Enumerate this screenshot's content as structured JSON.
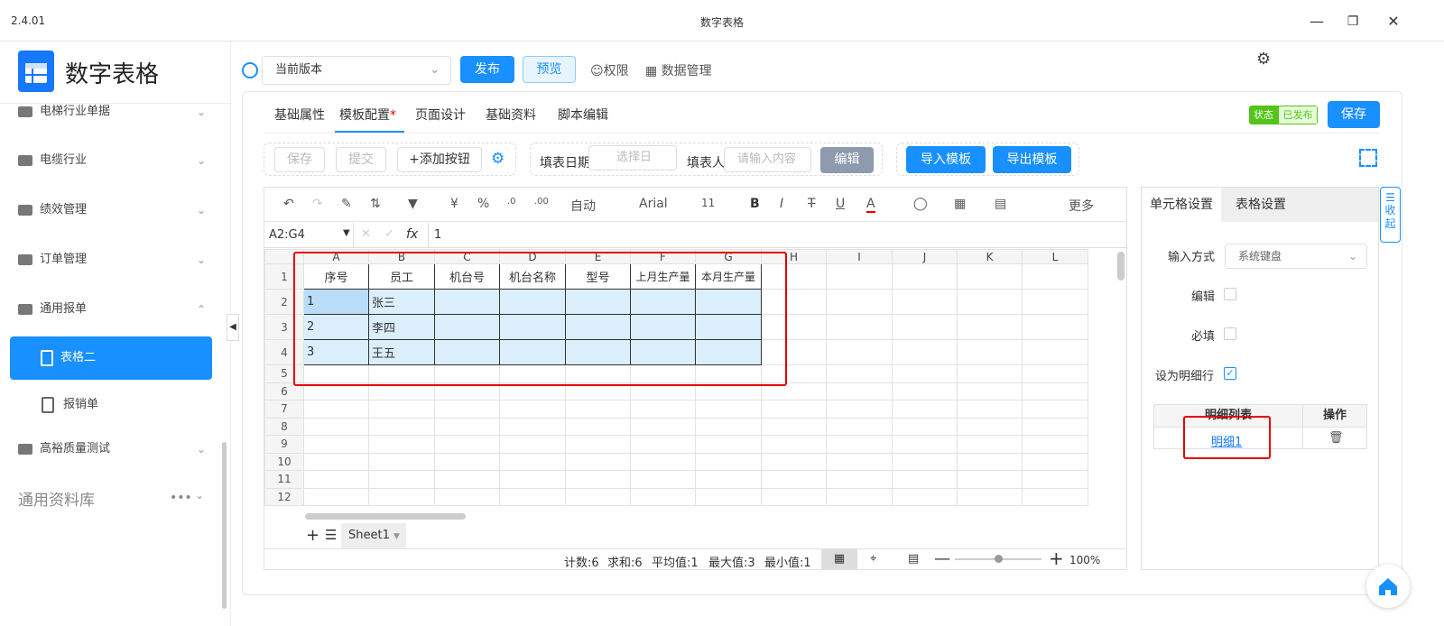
{
  "window": {
    "version": "2.4.01",
    "title": "数字表格"
  },
  "app": {
    "name": "数字表格",
    "accent": "#1890ff"
  },
  "sidebar": {
    "items": [
      {
        "label": "电梯行业单据"
      },
      {
        "label": "电缆行业"
      },
      {
        "label": "绩效管理"
      },
      {
        "label": "订单管理"
      },
      {
        "label": "通用报单"
      }
    ],
    "sub_items": [
      {
        "label": "表格二",
        "active": true
      },
      {
        "label": "报销单"
      }
    ],
    "more_items": [
      {
        "label": "高裕质量测试"
      }
    ],
    "library": "通用资料库"
  },
  "topbar": {
    "version_select": "当前版本",
    "publish": "发布",
    "preview": "预览",
    "permission": "权限",
    "data_manage": "数据管理"
  },
  "tabs": [
    {
      "label": "基础属性"
    },
    {
      "label": "模板配置"
    },
    {
      "label": "页面设计"
    },
    {
      "label": "基础资料"
    },
    {
      "label": "脚本编辑"
    }
  ],
  "tab_required_mark": "*",
  "status": {
    "label": "状态",
    "value": "已发布"
  },
  "save": "保存",
  "form": {
    "save": "保存",
    "submit": "提交",
    "add_button": "+添加按钮",
    "date_label": "填表日期",
    "date_placeholder": "选择日",
    "person_label": "填表人",
    "person_placeholder": "请输入内容",
    "edit": "编辑",
    "import": "导入模板",
    "export": "导出模板"
  },
  "format_bar": {
    "currency": "¥",
    "percent": "%",
    "number_format": "自动",
    "font": "Arial",
    "size": "11",
    "more": "更多"
  },
  "formula": {
    "cell_ref": "A2:G4",
    "fx": "fx",
    "value": "1"
  },
  "sheet": {
    "columns": [
      "A",
      "B",
      "C",
      "D",
      "E",
      "F",
      "G",
      "H",
      "I",
      "J",
      "K",
      "L"
    ],
    "header_row": [
      "序号",
      "员工",
      "机台号",
      "机台名称",
      "型号",
      "上月生产量",
      "本月生产量"
    ],
    "rows": [
      [
        "1",
        "张三"
      ],
      [
        "2",
        "李四"
      ],
      [
        "3",
        "王五"
      ]
    ],
    "row_numbers": [
      "1",
      "2",
      "3",
      "4",
      "5",
      "6",
      "7",
      "8",
      "9",
      "10",
      "11",
      "12"
    ]
  },
  "sheet_tab": "Sheet1",
  "status_bar": {
    "count": "计数:6",
    "sum": "求和:6",
    "avg": "平均值:1",
    "max": "最大值:3",
    "min": "最小值:1",
    "zoom": "100%"
  },
  "panel": {
    "tab_cell": "单元格设置",
    "tab_table": "表格设置",
    "input_method_label": "输入方式",
    "input_method_value": "系统键盘",
    "editable_label": "编辑",
    "required_label": "必填",
    "detail_row_label": "设为明细行",
    "detail_row_checked": true,
    "detail_table": {
      "col1": "明细列表",
      "col2": "操作",
      "row": "明细1"
    }
  },
  "collapse_tab": "收起"
}
